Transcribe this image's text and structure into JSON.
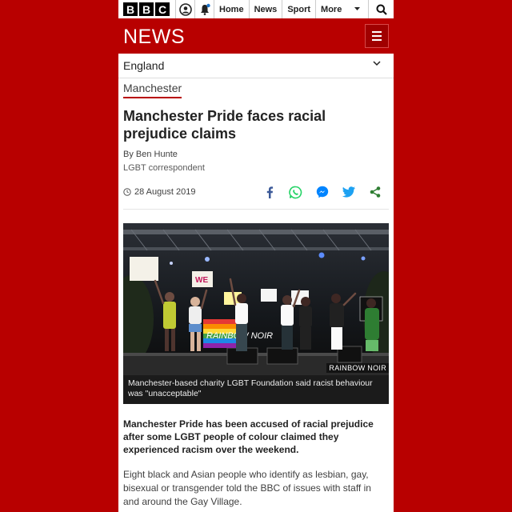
{
  "brand": {
    "letters": [
      "B",
      "B",
      "C"
    ]
  },
  "top_nav": {
    "links": [
      "Home",
      "News",
      "Sport"
    ],
    "more_label": "More"
  },
  "header": {
    "title": "NEWS"
  },
  "region": {
    "label": "England"
  },
  "article": {
    "section": "Manchester",
    "headline": "Manchester Pride faces racial prejudice claims",
    "author": "By Ben Hunte",
    "role": "LGBT correspondent",
    "date": "28 August 2019",
    "image": {
      "credit": "RAINBOW NOIR",
      "caption": "Manchester-based charity LGBT Foundation said racist behaviour was \"unacceptable\"",
      "signs": [
        "WE",
        "RAINBOW NOIR"
      ]
    },
    "intro": "Manchester Pride has been accused of racial prejudice after some LGBT people of colour claimed they experienced racism over the weekend.",
    "body": "Eight black and Asian people who identify as lesbian, gay, bisexual or transgender told the BBC of issues with staff in and around the Gay Village."
  },
  "share": [
    {
      "name": "facebook-icon",
      "color": "#3b5998"
    },
    {
      "name": "whatsapp-icon",
      "color": "#25d366"
    },
    {
      "name": "messenger-icon",
      "color": "#0084ff"
    },
    {
      "name": "twitter-icon",
      "color": "#1da1f2"
    },
    {
      "name": "share-icon",
      "color": "#2e7d32"
    }
  ],
  "colors": {
    "brand_red": "#b80000"
  }
}
